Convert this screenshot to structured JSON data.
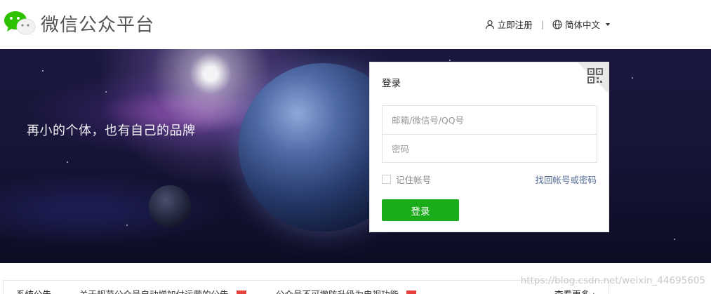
{
  "header": {
    "brand_title": "微信公众平台",
    "nav": {
      "register_label": "立即注册",
      "separator": "|",
      "language_label": "简体中文"
    }
  },
  "banner": {
    "slogan": "再小的个体，也有自己的品牌"
  },
  "login": {
    "title": "登录",
    "account_placeholder": "邮箱/微信号/QQ号",
    "password_placeholder": "密码",
    "remember_label": "记住帐号",
    "forgot_label": "找回帐号或密码",
    "submit_label": "登录"
  },
  "notice": {
    "label": "系统公告",
    "item1": "关于规范公众号自动增加付运营的公告",
    "item2": "公众号不可撤防升级为电视功能",
    "more_label": "查看更多 ›"
  },
  "watermark": "https://blog.csdn.net/weixin_44695605",
  "colors": {
    "primary_green": "#1aad19",
    "link_blue": "#576b95",
    "new_badge_red": "#e64340"
  },
  "icons": {
    "logo": "wechat-logo-icon",
    "register": "user-icon",
    "language": "globe-icon",
    "qr": "qr-code-icon"
  }
}
